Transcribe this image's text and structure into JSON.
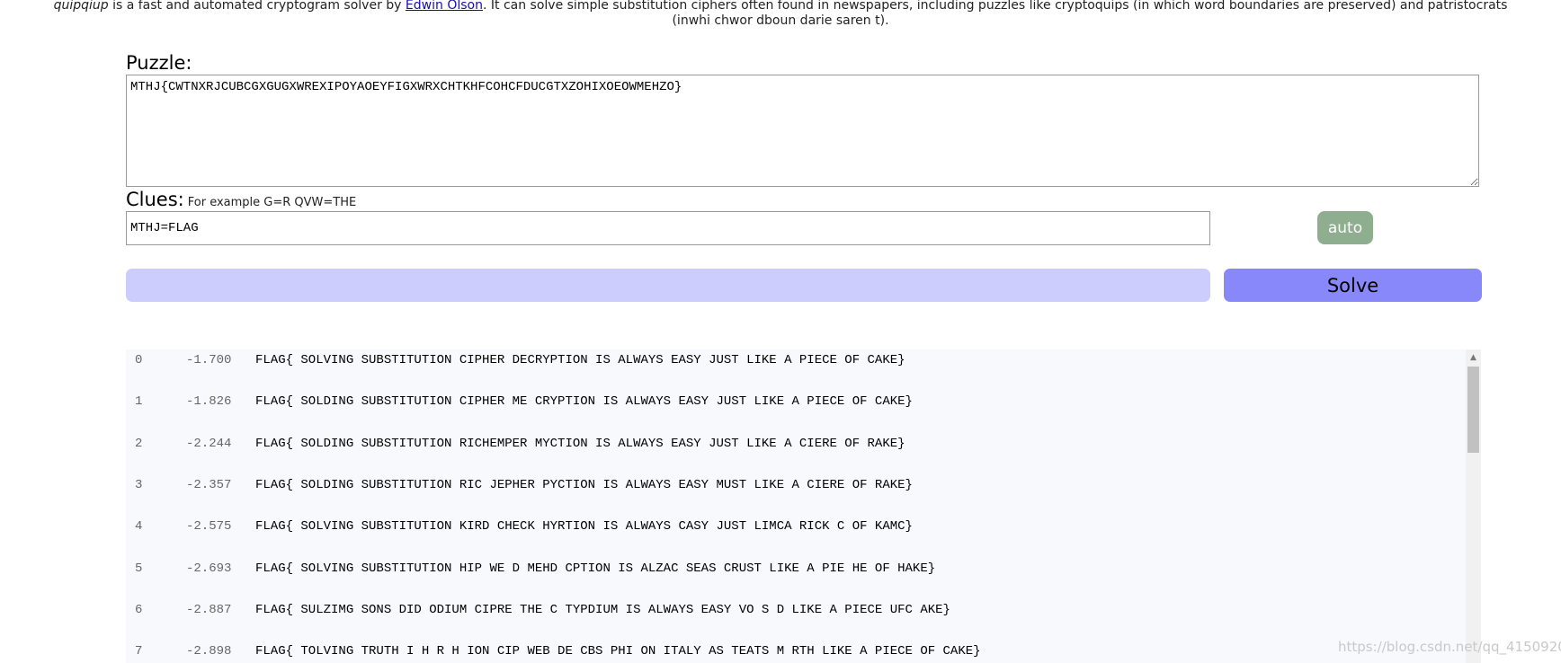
{
  "intro": {
    "brand": "quipqiup",
    "text1": " is a fast and automated cryptogram solver by ",
    "author_link": "Edwin Olson",
    "text2": ". It can solve simple substitution ciphers often found in newspapers, including puzzles like cryptoquips (in which word boundaries are preserved) and patristocrats",
    "line2": "(inwhi chwor dboun darie saren t)."
  },
  "puzzle": {
    "label": "Puzzle:",
    "value": "MTHJ{CWTNXRJCUBCGXGUGXWREXIPOYAOEYFIGXWRXCHTKHFCOHCFDUCGTXZOHIXOEOWMEHZO}"
  },
  "clues": {
    "label": "Clues:",
    "hint": "For example G=R QVW=THE",
    "value": "MTHJ=FLAG"
  },
  "buttons": {
    "auto": "auto",
    "solve": "Solve"
  },
  "progress": {
    "fraction": 0
  },
  "results": [
    {
      "idx": "0",
      "score": "-1.700",
      "text": "FLAG{ SOLVING SUBSTITUTION CIPHER DECRYPTION IS ALWAYS EASY JUST LIKE A PIECE OF CAKE}"
    },
    {
      "idx": "1",
      "score": "-1.826",
      "text": "FLAG{ SOLDING SUBSTITUTION CIPHER ME CRYPTION IS ALWAYS EASY JUST LIKE A PIECE OF CAKE}"
    },
    {
      "idx": "2",
      "score": "-2.244",
      "text": "FLAG{ SOLDING SUBSTITUTION RICHEMPER MYCTION IS ALWAYS EASY JUST LIKE A CIERE OF RAKE}"
    },
    {
      "idx": "3",
      "score": "-2.357",
      "text": "FLAG{ SOLDING SUBSTITUTION RIC JEPHER PYCTION IS ALWAYS EASY MUST LIKE A CIERE OF RAKE}"
    },
    {
      "idx": "4",
      "score": "-2.575",
      "text": "FLAG{ SOLVING SUBSTITUTION KIRD CHECK HYRTION IS ALWAYS CASY JUST LIMCA RICK C OF KAMC}"
    },
    {
      "idx": "5",
      "score": "-2.693",
      "text": "FLAG{ SOLVING SUBSTITUTION HIP WE D MEHD CPTION IS ALZAC SEAS CRUST LIKE A PIE HE OF HAKE}"
    },
    {
      "idx": "6",
      "score": "-2.887",
      "text": "FLAG{ SULZIMG SONS DID ODIUM CIPRE THE C TYPDIUM IS ALWAYS EASY VO S D LIKE A PIECE UFC AKE}"
    },
    {
      "idx": "7",
      "score": "-2.898",
      "text": "FLAG{ TOLVING TRUTH I H R H ION CIP WEB DE CBS PHI ON ITALY AS TEATS M RTH LIKE A PIECE OF CAKE}"
    }
  ],
  "watermark": "https://blog.csdn.net/qq_41509200",
  "colors": {
    "auto_button": "#8fae8f",
    "solve_button": "#8888fb",
    "progress_track": "#cccdfc",
    "results_bg": "#f8f9fd",
    "link": "#1a0dab"
  }
}
